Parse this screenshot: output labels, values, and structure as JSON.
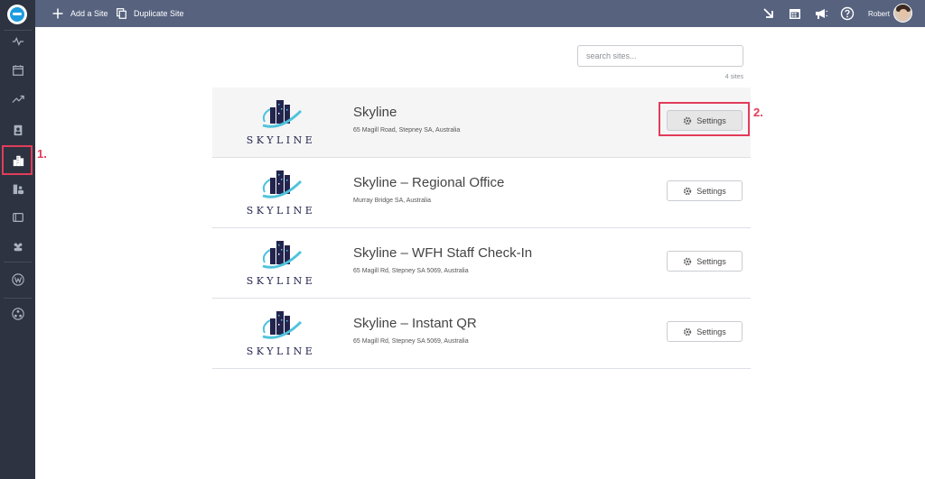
{
  "sidebar": {
    "items": [
      {
        "icon": "activity-icon"
      },
      {
        "icon": "calendar-icon"
      },
      {
        "icon": "trending-up-icon"
      },
      {
        "icon": "clipboard-user-icon"
      },
      {
        "icon": "sites-building-icon"
      },
      {
        "icon": "user-building-icon"
      },
      {
        "icon": "screen-icon"
      },
      {
        "icon": "users-group-icon"
      },
      {
        "icon": "w-badge-icon"
      },
      {
        "icon": "network-icon"
      }
    ]
  },
  "annotations": {
    "step1": "1.",
    "step2": "2."
  },
  "toolbar": {
    "add_site_label": "Add a Site",
    "duplicate_site_label": "Duplicate Site",
    "user_name": "Robert"
  },
  "search": {
    "placeholder": "search sites...",
    "count_text": "4 sites"
  },
  "brand": {
    "logo_text": "SKYLINE",
    "colors": {
      "navy": "#23244e",
      "cyan": "#4fc3dc",
      "accent_red": "#e23c5a",
      "topbar": "#56627e",
      "sidebar": "#2d3340"
    }
  },
  "sites": [
    {
      "name": "Skyline",
      "address": "65 Magill Road, Stepney SA, Australia",
      "settings_label": "Settings"
    },
    {
      "name": "Skyline – Regional Office",
      "address": "Murray Bridge SA, Australia",
      "settings_label": "Settings"
    },
    {
      "name": "Skyline – WFH Staff Check-In",
      "address": "65 Magill Rd, Stepney SA 5069, Australia",
      "settings_label": "Settings"
    },
    {
      "name": "Skyline – Instant QR",
      "address": "65 Magill Rd, Stepney SA 5069, Australia",
      "settings_label": "Settings"
    }
  ]
}
